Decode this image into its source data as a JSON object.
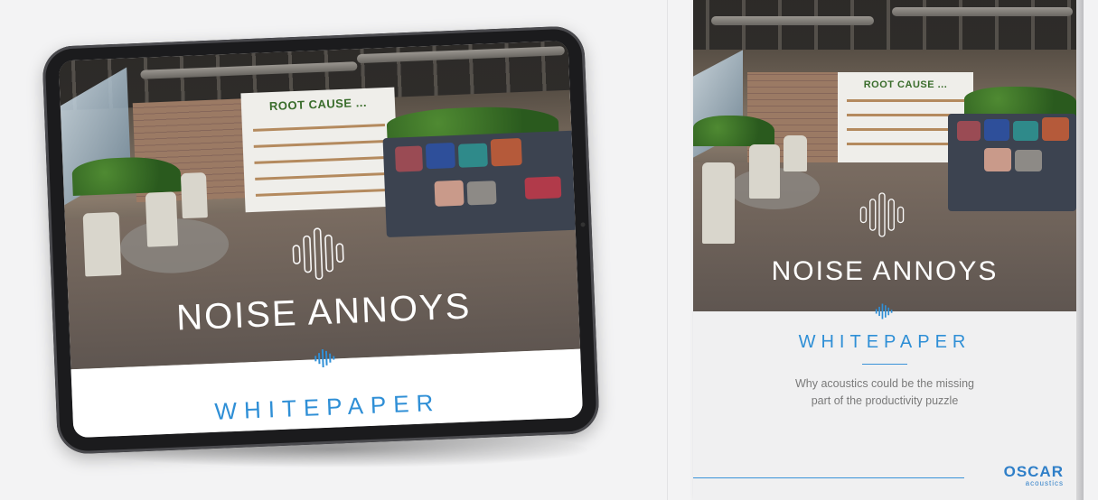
{
  "cover": {
    "sign_text": "ROOT CAUSE ...",
    "title": "NOISE ANNOYS",
    "subtitle": "WHITEPAPER"
  },
  "booklet": {
    "sign_text": "ROOT CAUSE ...",
    "title": "NOISE ANNOYS",
    "subtitle": "WHITEPAPER",
    "description_line1": "Why acoustics could be the missing",
    "description_line2": "part of the productivity puzzle",
    "logo_brand": "OSCAR",
    "logo_tagline": "acoustics"
  },
  "colors": {
    "accent_blue": "#2f8fd6",
    "page_background": "#f3f3f4"
  }
}
